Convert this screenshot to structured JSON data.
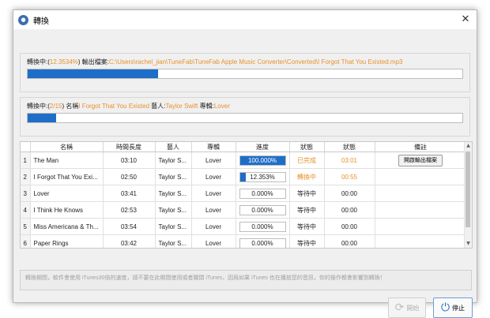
{
  "window": {
    "title": "轉換",
    "app_icon": "app-icon",
    "close": "✕"
  },
  "panel1": {
    "prefix": "轉換中:(",
    "percent": "12.3534%",
    "output_label": ") 輸出檔案:",
    "output_path": "C:\\Users\\rachel_jian\\TuneFab\\TuneFab Apple Music Converter\\Converted\\I Forgot That You Existed.mp3",
    "progress": 0.3
  },
  "panel2": {
    "prefix": "轉換中:(",
    "count": "2/15",
    "name_label": ") 名稱",
    "name": "I Forgot That You Existed",
    "artist_label": " 藝人:",
    "artist": "Taylor Swift",
    "album_label": " 專輯:",
    "album": "Lover",
    "progress": 0.066
  },
  "table": {
    "headers": [
      "",
      "名稱",
      "時間長度",
      "藝人",
      "專輯",
      "進度",
      "狀態",
      "狀態",
      "備註"
    ],
    "rows": [
      {
        "num": "1",
        "name": "The Man",
        "duration": "03:10",
        "artist": "Taylor S...",
        "album": "Lover",
        "progress_text": "100.000%",
        "progress": 1.0,
        "status": "已完成",
        "time": "03:01",
        "note": "開啟輸出檔案"
      },
      {
        "num": "2",
        "name": "I Forgot That You Exi...",
        "duration": "02:50",
        "artist": "Taylor S...",
        "album": "Lover",
        "progress_text": "12.353%",
        "progress": 0.12353,
        "status": "轉換中",
        "time": "00:55",
        "note": ""
      },
      {
        "num": "3",
        "name": "Lover",
        "duration": "03:41",
        "artist": "Taylor S...",
        "album": "Lover",
        "progress_text": "0.000%",
        "status": "等待中",
        "time": "00:00",
        "note": ""
      },
      {
        "num": "4",
        "name": "I Think He Knows",
        "duration": "02:53",
        "artist": "Taylor S...",
        "album": "Lover",
        "progress_text": "0.000%",
        "status": "等待中",
        "time": "00:00",
        "note": ""
      },
      {
        "num": "5",
        "name": "Miss Americana & Th...",
        "duration": "03:54",
        "artist": "Taylor S...",
        "album": "Lover",
        "progress_text": "0.000%",
        "status": "等待中",
        "time": "00:00",
        "note": ""
      },
      {
        "num": "6",
        "name": "Paper Rings",
        "duration": "03:42",
        "artist": "Taylor S...",
        "album": "Lover",
        "progress_text": "0.000%",
        "status": "等待中",
        "time": "00:00",
        "note": ""
      }
    ]
  },
  "note": "轉換期間，軟件會使用 iTunes30倍的速度，請不要在此期間使用或者關閉 iTunes，因爲如果 iTunes 也在播放您的音訊，你的操作都會影響到轉換！",
  "buttons": {
    "start": "開始",
    "stop": "停止"
  },
  "colors": {
    "accent": "#1e6ec8",
    "orange": "#e8912a"
  }
}
